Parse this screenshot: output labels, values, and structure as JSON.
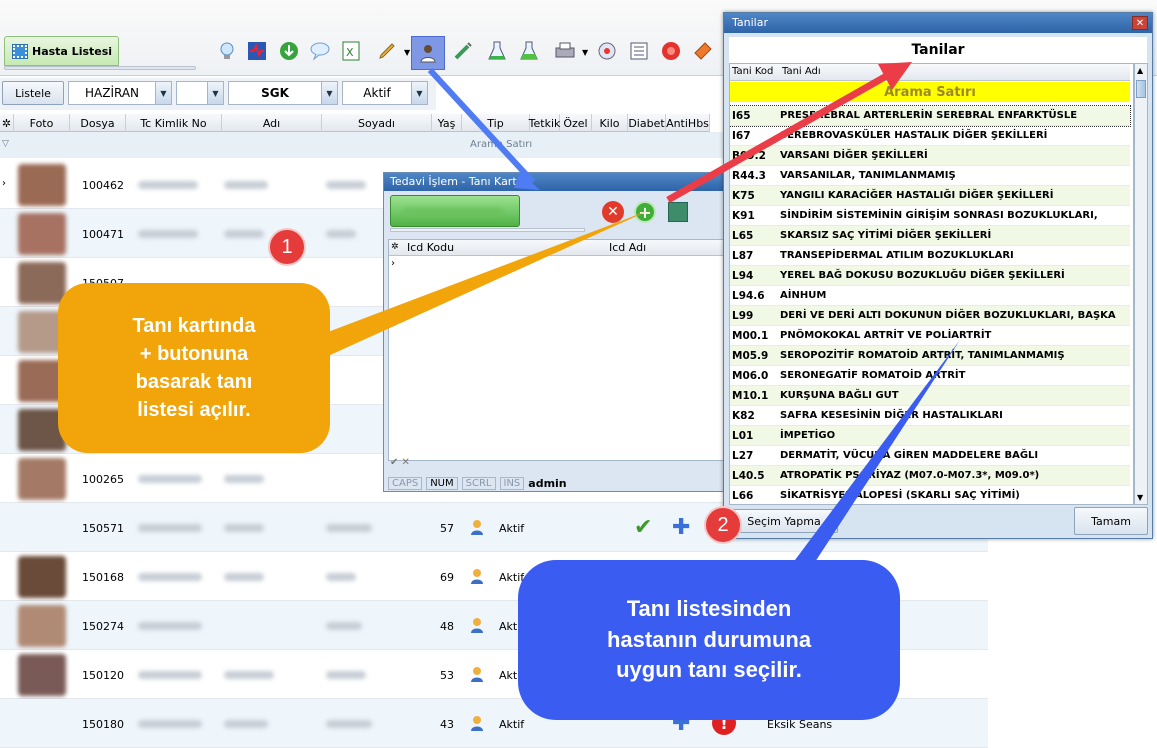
{
  "toolbar": {
    "tab_label": "Hasta Listesi",
    "icons": [
      "lightbulb-icon",
      "heart-pulse-icon",
      "globe-download-icon",
      "chat-icon",
      "excel-icon",
      "pencil-icon",
      "doctor-icon",
      "syringe-icon",
      "flask-icon",
      "beaker-icon",
      "printer-icon",
      "settings-icon",
      "checklist-icon",
      "record-icon",
      "ticket-icon"
    ]
  },
  "filter": {
    "list_button": "Listele",
    "month": "HAZİRAN",
    "blank": "",
    "insurance": "SGK",
    "status": "Aktif"
  },
  "grid": {
    "headers": [
      "Foto",
      "Dosya",
      "Tc Kimlik No",
      "Adı",
      "Soyadı",
      "Yaş",
      "Tip",
      "Tetkik",
      "Özel",
      "Kilo",
      "Diabet",
      "AntiHbs"
    ],
    "filter_row": "Arama Satırı",
    "rows": [
      {
        "dosya": "100462",
        "yas": "",
        "tip": ""
      },
      {
        "dosya": "100471",
        "yas": "",
        "tip": ""
      },
      {
        "dosya": "150507",
        "yas": "",
        "tip": ""
      },
      {
        "dosya": "",
        "yas": "",
        "tip": ""
      },
      {
        "dosya": "",
        "yas": "",
        "tip": ""
      },
      {
        "dosya": "",
        "yas": "",
        "tip": ""
      },
      {
        "dosya": "100265",
        "yas": "",
        "tip": ""
      },
      {
        "dosya": "150571",
        "yas": "57",
        "tip": "Aktif"
      },
      {
        "dosya": "150168",
        "yas": "69",
        "tip": "Aktif"
      },
      {
        "dosya": "150274",
        "yas": "48",
        "tip": "Aktif"
      },
      {
        "dosya": "150120",
        "yas": "53",
        "tip": "Aktif"
      },
      {
        "dosya": "150180",
        "yas": "43",
        "tip": "Aktif",
        "note": "Eksik Seans"
      }
    ]
  },
  "dialog1": {
    "title": "Tedavi İşlem - Tanı Kartı",
    "col1": "Icd Kodu",
    "col2": "Icd Adı",
    "status": [
      "CAPS",
      "NUM",
      "SCRL",
      "INS"
    ],
    "user": "admin"
  },
  "dialog2": {
    "title": "Tanilar",
    "heading": "Tanilar",
    "col1": "Tani Kod",
    "col2": "Tani Adı",
    "search_row": "Arama Satırı",
    "rows": [
      {
        "k": "I65",
        "n": "PRESEREBRAL ARTERLERİN SEREBRAL ENFARKTÜSLE"
      },
      {
        "k": "I67",
        "n": "SEREBROVASKÜLER HASTALIK DİĞER ŞEKİLLERİ"
      },
      {
        "k": "B09.2",
        "n": "VARSANI DİĞER ŞEKİLLERİ"
      },
      {
        "k": "R44.3",
        "n": "VARSANILAR, TANIMLANMAMIŞ"
      },
      {
        "k": "K75",
        "n": "YANGILI KARACİĞER HASTALIĞI DİĞER ŞEKİLLERİ"
      },
      {
        "k": "K91",
        "n": "SİNDİRİM SİSTEMİNİN GİRİŞİM SONRASI BOZUKLUKLARI,"
      },
      {
        "k": "L65",
        "n": "SKARSIZ SAÇ YİTİMİ DİĞER ŞEKİLLERİ"
      },
      {
        "k": "L87",
        "n": "TRANSEPİDERMAL ATILIM BOZUKLUKLARI"
      },
      {
        "k": "L94",
        "n": "YEREL BAĞ DOKUSU BOZUKLUĞU DİĞER ŞEKİLLERİ"
      },
      {
        "k": "L94.6",
        "n": "AİNHUM"
      },
      {
        "k": "L99",
        "n": "DERİ VE DERİ ALTI DOKUNUN DİĞER BOZUKLUKLARI, BAŞKA"
      },
      {
        "k": "M00.1",
        "n": "PNÖMOKOKAL ARTRİT VE POLİARTRİT"
      },
      {
        "k": "M05.9",
        "n": "SEROPOZİTİF ROMATOİD ARTRİT, TANIMLANMAMIŞ"
      },
      {
        "k": "M06.0",
        "n": "SERONEGATİF ROMATOİD ARTRİT"
      },
      {
        "k": "M10.1",
        "n": "KURŞUNA BAĞLI GUT"
      },
      {
        "k": "K82",
        "n": "SAFRA KESESİNİN DİĞER HASTALIKLARI"
      },
      {
        "k": "L01",
        "n": "İMPETİGO"
      },
      {
        "k": "L27",
        "n": "DERMATİT, VÜCUDA GİREN MADDELERE BAĞLI"
      },
      {
        "k": "L40.5",
        "n": "ATROPATİK PSORİYAZ (M07.0-M07.3*, M09.0*)"
      },
      {
        "k": "L66",
        "n": "SİKATRİSYEL ALOPESİ (SKARLI SAÇ YİTİMİ)"
      }
    ],
    "select_button": "Seçim Yapma",
    "ok_button": "Tamam"
  },
  "callouts": {
    "one_num": "1",
    "one_text": "Tanı kartında\n+ butonuna\nbasarak tanı\nlistesi açılır.",
    "two_num": "2",
    "two_text": "Tanı listesinden\nhastanın durumuna\nuygun tanı seçilir."
  },
  "colors": {
    "callout_orange": "#f2a40b",
    "callout_blue": "#3b5cf0",
    "arrow_red": "#ea3d48",
    "highlight_yellow": "#ffff00"
  }
}
